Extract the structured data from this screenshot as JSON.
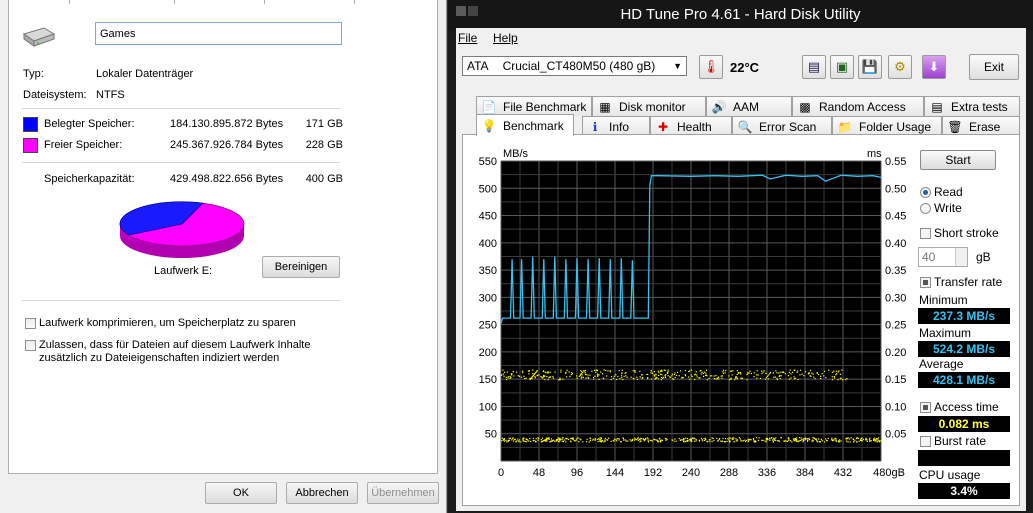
{
  "properties": {
    "drive_name": "Games",
    "type_label": "Typ:",
    "type_value": "Lokaler Datenträger",
    "fs_label": "Dateisystem:",
    "fs_value": "NTFS",
    "used": {
      "label": "Belegter Speicher:",
      "bytes": "184.130.895.872 Bytes",
      "size": "171 GB",
      "color": "#0000ff"
    },
    "free": {
      "label": "Freier Speicher:",
      "bytes": "245.367.926.784 Bytes",
      "size": "228 GB",
      "color": "#ff00ff"
    },
    "capacity": {
      "label": "Speicherkapazität:",
      "bytes": "429.498.822.656 Bytes",
      "size": "400 GB"
    },
    "drive_label": "Laufwerk E:",
    "cleanup_button": "Bereinigen",
    "compress_checkbox": "Laufwerk komprimieren, um Speicherplatz zu sparen",
    "index_checkbox_line1": "Zulassen, dass für Dateien auf diesem Laufwerk Inhalte",
    "index_checkbox_line2": "zusätzlich zu Dateieigenschaften indiziert werden",
    "ok_button": "OK",
    "cancel_button": "Abbrechen",
    "apply_button": "Übernehmen"
  },
  "hdtune": {
    "title": "HD Tune Pro 4.61 - Hard Disk Utility",
    "menu": {
      "file": "File",
      "help": "Help"
    },
    "drive": {
      "interface": "ATA",
      "model": "Crucial_CT480M50 (480 gB)"
    },
    "temperature": "22°C",
    "exit_button": "Exit",
    "tabs_row1": [
      "File Benchmark",
      "Disk monitor",
      "AAM",
      "Random Access",
      "Extra tests"
    ],
    "tabs_row2": [
      "Benchmark",
      "Info",
      "Health",
      "Error Scan",
      "Folder Usage",
      "Erase"
    ],
    "start_button": "Start",
    "read_label": "Read",
    "write_label": "Write",
    "short_stroke_label": "Short stroke",
    "short_stroke_value": "40",
    "short_stroke_unit": "gB",
    "transfer_rate_label": "Transfer rate",
    "minimum_label": "Minimum",
    "minimum_value": "237.3 MB/s",
    "maximum_label": "Maximum",
    "maximum_value": "524.2 MB/s",
    "average_label": "Average",
    "average_value": "428.1 MB/s",
    "access_time_label": "Access time",
    "access_time_value": "0.082 ms",
    "burst_rate_label": "Burst rate",
    "burst_rate_value": "",
    "cpu_usage_label": "CPU usage",
    "cpu_usage_value": "3.4%",
    "stat_color_blue": "#36c0f0",
    "stat_color_yellow": "#ffff40"
  },
  "chart_data": {
    "type": "line",
    "x_unit_label": "gB",
    "y_left_label": "MB/s",
    "y_right_label": "ms",
    "xlim": [
      0,
      480
    ],
    "ylim_left": [
      0,
      550
    ],
    "ylim_right": [
      0,
      0.55
    ],
    "x_ticks": [
      "0",
      "48",
      "96",
      "144",
      "192",
      "240",
      "288",
      "336",
      "384",
      "432",
      "480gB"
    ],
    "y_left_ticks": [
      "50",
      "100",
      "150",
      "200",
      "250",
      "300",
      "350",
      "400",
      "450",
      "500",
      "550"
    ],
    "y_right_ticks": [
      "0.05",
      "0.10",
      "0.15",
      "0.20",
      "0.25",
      "0.30",
      "0.35",
      "0.40",
      "0.45",
      "0.50",
      "0.55"
    ],
    "grid": true,
    "series": [
      {
        "kind": "transfer_rate",
        "color": "#36c0f0",
        "x": [
          0,
          2,
          8,
          12,
          14,
          16,
          24,
          26,
          28,
          38,
          40,
          42,
          52,
          54,
          56,
          66,
          68,
          70,
          80,
          82,
          84,
          94,
          96,
          98,
          108,
          110,
          112,
          122,
          124,
          126,
          136,
          138,
          140,
          150,
          152,
          154,
          164,
          166,
          168,
          178,
          182,
          186,
          188,
          190,
          200,
          240,
          270,
          300,
          330,
          340,
          360,
          380,
          400,
          410,
          430,
          450,
          470,
          480
        ],
        "y": [
          252,
          262,
          262,
          262,
          370,
          262,
          262,
          370,
          262,
          262,
          375,
          262,
          262,
          370,
          262,
          262,
          375,
          262,
          262,
          370,
          262,
          262,
          372,
          262,
          262,
          370,
          262,
          262,
          372,
          262,
          262,
          370,
          262,
          262,
          372,
          262,
          262,
          368,
          262,
          262,
          262,
          262,
          505,
          523,
          523,
          522,
          523,
          522,
          524,
          517,
          524,
          522,
          523,
          513,
          524,
          522,
          523,
          520
        ]
      },
      {
        "kind": "access_time_band_1",
        "color": "#ffff00",
        "x_range": [
          0,
          440
        ],
        "ms_range": [
          0.15,
          0.168
        ]
      },
      {
        "kind": "access_time_band_2",
        "color": "#ffff00",
        "x_range": [
          0,
          480
        ],
        "ms_range": [
          0.036,
          0.044
        ]
      }
    ]
  }
}
